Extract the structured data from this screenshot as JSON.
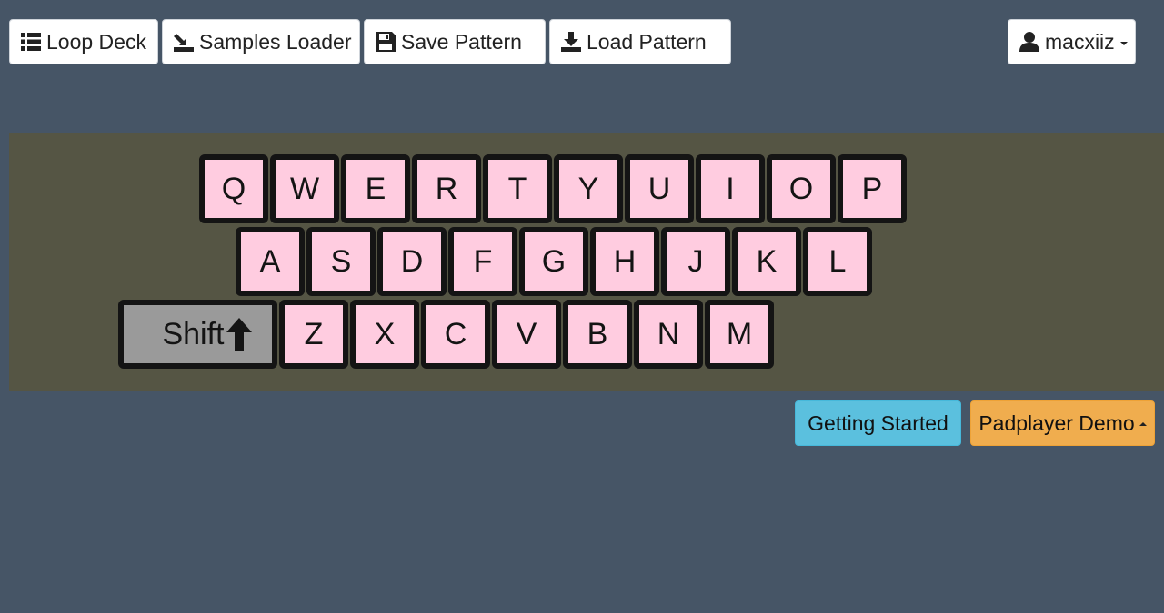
{
  "toolbar": {
    "loop_deck": "Loop Deck",
    "samples_loader": "Samples Loader",
    "save_pattern": "Save Pattern",
    "load_pattern": "Load Pattern",
    "user": "macxiiz"
  },
  "keyboard": {
    "row1": [
      "Q",
      "W",
      "E",
      "R",
      "T",
      "Y",
      "U",
      "I",
      "O",
      "P"
    ],
    "row2": [
      "A",
      "S",
      "D",
      "F",
      "G",
      "H",
      "J",
      "K",
      "L"
    ],
    "row3": [
      "Z",
      "X",
      "C",
      "V",
      "B",
      "N",
      "M"
    ],
    "shift_label": "Shift"
  },
  "actions": {
    "getting_started": "Getting Started",
    "padplayer_demo": "Padplayer Demo"
  },
  "colors": {
    "background": "#465566",
    "keyboard_panel": "#555544",
    "key_face": "#ffcce0",
    "shift_face": "#9a9a9a",
    "getting_started": "#5bc0de",
    "padplayer_demo": "#f0ad4e"
  }
}
